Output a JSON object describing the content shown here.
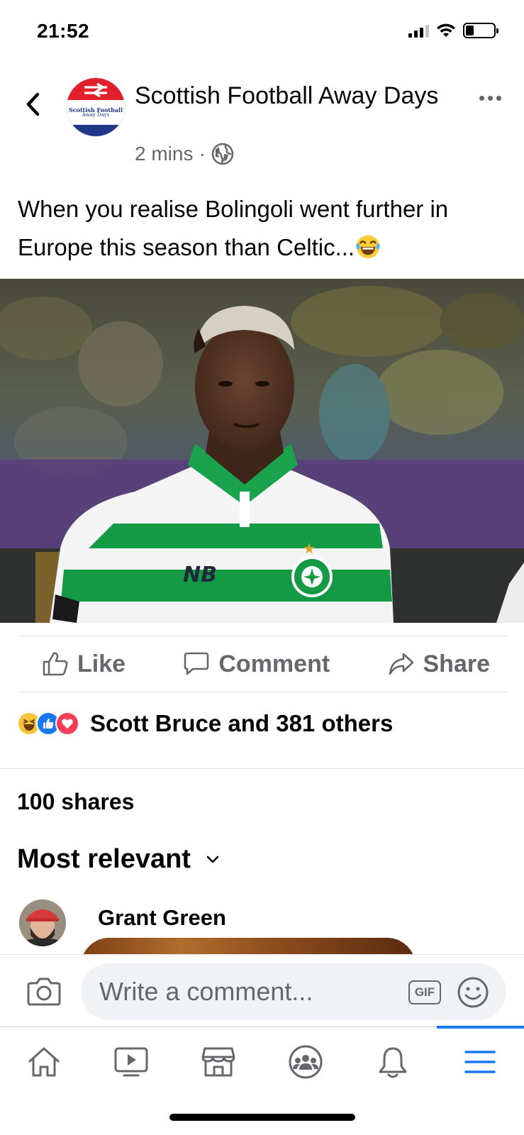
{
  "status_bar": {
    "time": "21:52",
    "battery_level": 0.3
  },
  "post": {
    "page_name": "Scottish Football Away Days",
    "page_logo_text_line1": "Scottish Football",
    "page_logo_text_line2": "Away Days",
    "time_ago": "2 mins",
    "separator": "·",
    "privacy_icon": "globe-icon",
    "text": "When you realise Bolingoli went further in Europe this season than Celtic...",
    "emoji": "face-with-tears-of-joy",
    "image_alt": "Footballer in green and white hooped Celtic kit"
  },
  "actions": {
    "like_label": "Like",
    "comment_label": "Comment",
    "share_label": "Share"
  },
  "reactions": {
    "icons": [
      "haha-icon",
      "like-icon",
      "love-icon"
    ],
    "summary": "Scott Bruce and 381 others"
  },
  "shares": "100 shares",
  "comments": {
    "sort_label": "Most relevant",
    "first_commenter": "Grant Green"
  },
  "composer": {
    "placeholder": "Write a comment...",
    "gif_label": "GIF"
  },
  "bottom_nav": {
    "tabs": [
      {
        "icon": "home-icon",
        "active": false
      },
      {
        "icon": "watch-icon",
        "active": false
      },
      {
        "icon": "marketplace-icon",
        "active": false
      },
      {
        "icon": "groups-icon",
        "active": false
      },
      {
        "icon": "notifications-icon",
        "active": false
      },
      {
        "icon": "menu-icon",
        "active": true
      }
    ]
  },
  "colors": {
    "accent": "#1877f2",
    "secondary_text": "#65676b",
    "celtic_green": "#149a45",
    "logo_red": "#e0212b",
    "logo_blue": "#1d3987"
  }
}
